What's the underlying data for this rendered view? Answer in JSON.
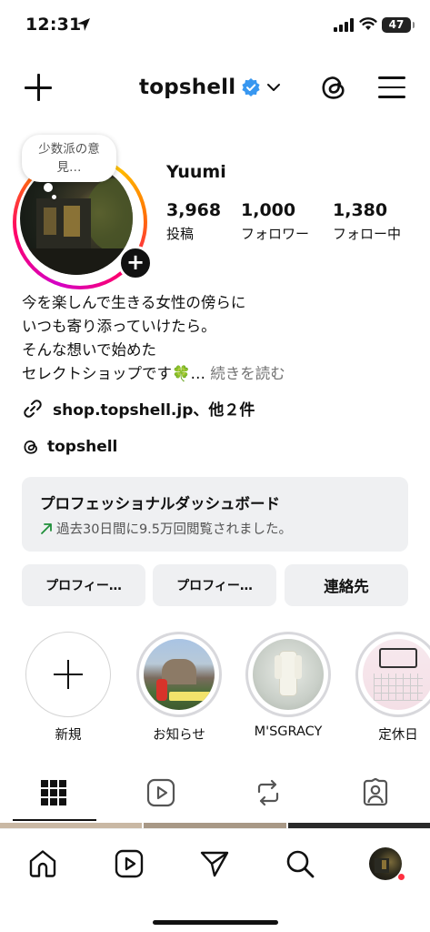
{
  "status_bar": {
    "time": "12:31",
    "battery": "47"
  },
  "header": {
    "username": "topshell",
    "verified": true,
    "icons": [
      "plus-icon",
      "verified-badge-icon",
      "chevron-down-icon",
      "threads-icon",
      "hamburger-menu-icon"
    ]
  },
  "profile": {
    "note": "少数派の意見…",
    "display_name": "Yuumi",
    "stats": [
      {
        "value": "3,968",
        "label": "投稿"
      },
      {
        "value": "1,000",
        "label": "フォロワー"
      },
      {
        "value": "1,380",
        "label": "フォロー中"
      }
    ],
    "bio_lines": [
      "今を楽しんで生きる女性の傍らに",
      "いつも寄り添っていけたら。",
      "そんな想いで始めた",
      "セレクトショップです🍀…"
    ],
    "bio_more": "続きを読む",
    "link": "shop.topshell.jp、他２件",
    "threads_handle": "topshell"
  },
  "dashboard": {
    "title": "プロフェッショナルダッシュボード",
    "subtitle": "過去30日間に9.5万回閲覧されました。"
  },
  "buttons": {
    "edit_profile": "プロフィー…",
    "share_profile": "プロフィー…",
    "contact": "連絡先"
  },
  "highlights": [
    {
      "label": "新規"
    },
    {
      "label": "お知らせ"
    },
    {
      "label": "M'SGRACY"
    },
    {
      "label": "定休日"
    }
  ],
  "tabs": [
    "grid-icon",
    "reels-icon",
    "reposts-icon",
    "tagged-icon"
  ],
  "bottom_nav": [
    "home-icon",
    "reels-icon",
    "send-icon",
    "search-icon",
    "profile-avatar"
  ],
  "colors": {
    "accent_green": "#1f8f3a",
    "verified_blue": "#3897f0",
    "notification_red": "#ff3040"
  }
}
